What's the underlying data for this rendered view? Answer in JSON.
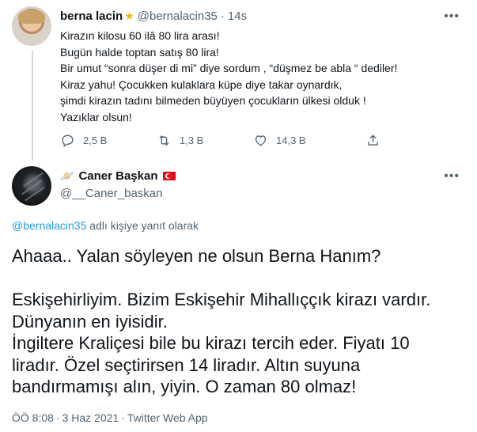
{
  "parent_tweet": {
    "name": "berna lacin",
    "badge_icon": "star-icon",
    "handle": "@bernalacin35",
    "separator": "·",
    "time": "14s",
    "more_icon": "more-icon",
    "lines": [
      "Kirazın kilosu 60 ilâ 80 lira arası!",
      "Bugün halde toptan satış 80 lira!",
      "Bir umut “sonra düşer di mi” diye sordum , “düşmez be abla “ dediler!",
      "Kiraz yahu! Çocukken kulaklara küpe diye takar oynardık,",
      "şimdi kirazın tadını bilmeden büyüyen çocukların ülkesi olduk !",
      "Yazıklar olsun!"
    ],
    "actions": {
      "reply_count": "2,5 B",
      "retweet_count": "1,3 B",
      "like_count": "14,3 B"
    }
  },
  "main_tweet": {
    "prefix_icon": "planet-icon",
    "name": "Caner Başkan",
    "flag_icon": "turkey-flag-icon",
    "handle": "@__Caner_baskan",
    "reply_mention": "@bernalacin35",
    "reply_suffix": " adlı kişiye yanıt olarak",
    "lines": [
      "Ahaaa.. Yalan söyleyen ne olsun Berna Hanım?",
      "",
      "Eskişehirliyim. Bizim Eskişehir Mihallıççık kirazı vardır.",
      "Dünyanın en iyisidir.",
      "İngiltere Kraliçesi bile bu kirazı tercih eder. Fiyatı 10",
      "liradır. Özel seçtirirsen 14 liradır. Altın suyuna",
      "bandırmamışı alın, yiyin. O zaman 80 olmaz!"
    ],
    "time": "ÖÖ 8:08",
    "separator": "·",
    "date": "3 Haz 2021",
    "source": "Twitter Web App"
  }
}
